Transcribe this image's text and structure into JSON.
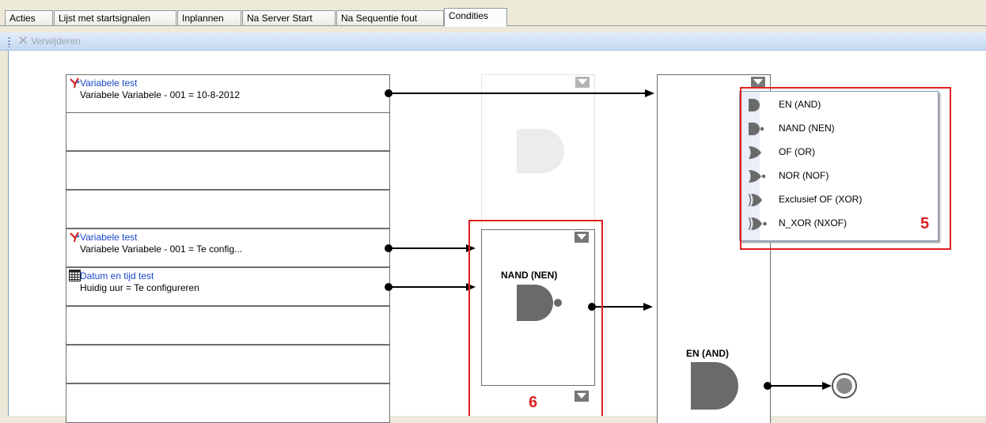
{
  "tabs": [
    {
      "label": "Acties"
    },
    {
      "label": "Lijst met startsignalen"
    },
    {
      "label": "Inplannen"
    },
    {
      "label": "Na Server Start"
    },
    {
      "label": "Na Sequentie fout"
    },
    {
      "label": "Condities",
      "active": true
    }
  ],
  "toolbar": {
    "delete_label": "Verwijderen"
  },
  "conditions": [
    {
      "title": "Variabele test",
      "subtitle": "Variabele Variabele - 001 = 10-8-2012",
      "icon": "variable-test-icon"
    },
    {
      "title": "",
      "subtitle": ""
    },
    {
      "title": "",
      "subtitle": ""
    },
    {
      "title": "",
      "subtitle": ""
    },
    {
      "title": "Variabele test",
      "subtitle": "Variabele Variabele - 001 = Te config...",
      "icon": "variable-test-icon"
    },
    {
      "title": "Datum en tijd test",
      "subtitle": "Huidig uur = Te configureren",
      "icon": "calendar-icon"
    },
    {
      "title": "",
      "subtitle": ""
    },
    {
      "title": "",
      "subtitle": ""
    },
    {
      "title": "",
      "subtitle": ""
    }
  ],
  "gates": {
    "middle": {
      "label": "NAND (NEN)"
    },
    "right": {
      "label": "EN (AND)"
    }
  },
  "menu": {
    "items": [
      {
        "label": "EN (AND)",
        "icon": "and-gate-icon"
      },
      {
        "label": "NAND (NEN)",
        "icon": "nand-gate-icon"
      },
      {
        "label": "OF (OR)",
        "icon": "or-gate-icon"
      },
      {
        "label": "NOR (NOF)",
        "icon": "nor-gate-icon"
      },
      {
        "label": "Exclusief OF (XOR)",
        "icon": "xor-gate-icon"
      },
      {
        "label": "N_XOR (NXOF)",
        "icon": "nxor-gate-icon"
      }
    ]
  },
  "annotations": {
    "menu_number": "5",
    "gate_number": "6",
    "color": "#e02020"
  }
}
